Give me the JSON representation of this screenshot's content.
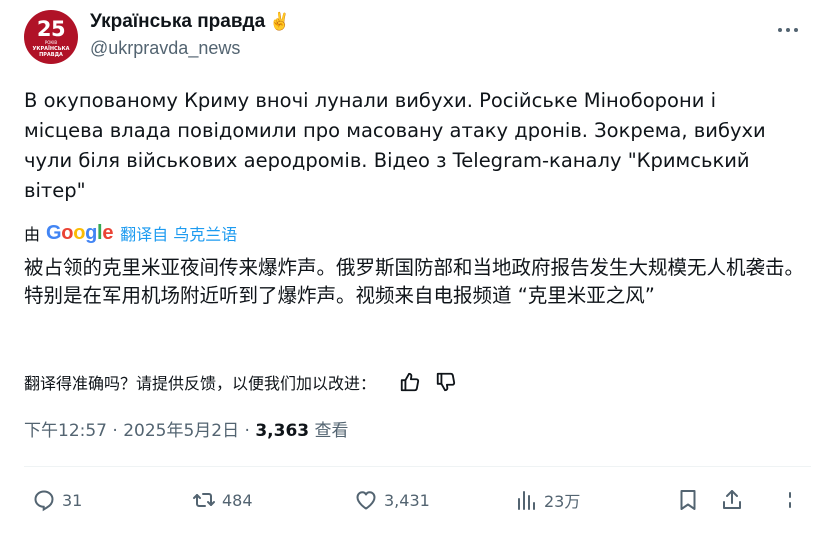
{
  "account": {
    "avatar_number": "25",
    "avatar_sub": "РОКІВ",
    "avatar_sub2": "УКРАЇНСЬКА ПРАВДА",
    "display_name": "Українська правда",
    "display_emoji": "✌",
    "handle": "@ukrpravda_news"
  },
  "tweet": {
    "text": "В окупованому Криму вночі лунали вибухи. Російське Міноборони і місцева влада повідомили про масовану атаку дронів. Зокрема, вибухи чули біля військових аеродромів. Відео з Telegram-каналу \"Кримський вітер\"",
    "translated_by_prefix": "由",
    "translator_name": "Google",
    "translated_from": "翻译自 乌克兰语",
    "translated_text": "被占领的克里米亚夜间传来爆炸声。俄罗斯国防部和当地政府报告发生大规模无人机袭击。特别是在军用机场附近听到了爆炸声。视频来自电报频道 “克里米亚之风”",
    "feedback_prompt": "翻译得准确吗？请提供反馈，以便我们加以改进：",
    "time": "下午12:57",
    "date": "2025年5月2日",
    "views_count": "3,363",
    "views_label": "查看",
    "separator": "·"
  },
  "actions": {
    "replies": "31",
    "reposts": "484",
    "likes": "3,431",
    "views": "23万"
  },
  "icons": {
    "more": "more-horizontal-icon",
    "thumb_up": "thumbs-up-icon",
    "thumb_down": "thumbs-down-icon",
    "reply": "reply-icon",
    "repost": "repost-icon",
    "like": "heart-icon",
    "views": "analytics-icon",
    "bookmark": "bookmark-icon",
    "share": "share-icon"
  },
  "colors": {
    "brand_red": "#b01227",
    "link_blue": "#1d9bf0",
    "muted_gray": "#536471",
    "text": "#0f1419"
  }
}
